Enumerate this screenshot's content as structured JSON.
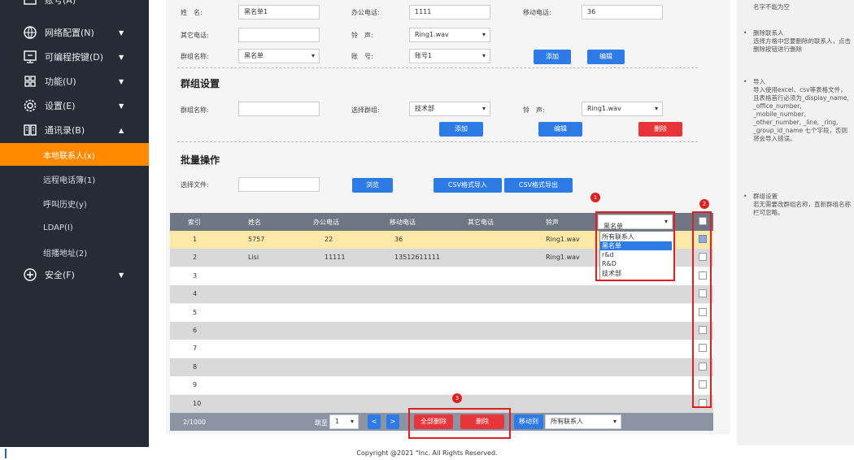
{
  "sidebar": {
    "top_partial_label": "账号(A)",
    "items": [
      {
        "label": "网络配置(N)",
        "icon": "globe-icon",
        "arrow": "▼"
      },
      {
        "label": "可编程按键(D)",
        "icon": "keyboard-icon",
        "arrow": "▼"
      },
      {
        "label": "功能(U)",
        "icon": "grid-icon",
        "arrow": "▼"
      },
      {
        "label": "设置(E)",
        "icon": "gear-icon",
        "arrow": "▼"
      },
      {
        "label": "通讯录(B)",
        "icon": "book-icon",
        "arrow": "▲"
      }
    ],
    "sub_items": [
      {
        "label": "本地联系人(x)",
        "active": true
      },
      {
        "label": "远程电话簿(1)",
        "active": false
      },
      {
        "label": "呼叫历史(y)",
        "active": false
      },
      {
        "label": "LDAP(I)",
        "active": false
      },
      {
        "label": "组播地址(2)",
        "active": false
      }
    ],
    "security": {
      "label": "安全(F)",
      "icon": "shield-plus-icon",
      "arrow": "▼"
    }
  },
  "contact_form": {
    "name_label": "姓　名:",
    "name_value": "黑名单1",
    "office_label": "办公电话:",
    "office_value": "1111",
    "mobile_label": "移动电话:",
    "mobile_value": "36",
    "other_label": "其它电话:",
    "other_value": "",
    "ring_label": "铃　声:",
    "ring_value": "Ring1.wav",
    "group_label": "群组名称:",
    "group_value": "黑名单",
    "account_label": "账　号:",
    "account_value": "账号1",
    "add_label": "添加",
    "edit_label": "编辑"
  },
  "group_settings": {
    "title": "群组设置",
    "group_name_label": "群组名称:",
    "group_name_value": "",
    "select_group_label": "选择群组:",
    "select_group_value": "技术部",
    "ring_label": "铃　声:",
    "ring_value": "Ring1.wav",
    "add_label": "添加",
    "edit_label": "编辑",
    "delete_label": "删除"
  },
  "batch": {
    "title": "批量操作",
    "file_label": "选择文件:",
    "file_value": "",
    "browse_label": "浏览",
    "import_label": "CSV格式导入",
    "export_label": "CSV格式导出"
  },
  "table": {
    "headers": [
      "索引",
      "姓名",
      "办公电话",
      "移动电话",
      "其它电话",
      "铃声"
    ],
    "filter_value": "黑名单",
    "filter_options": [
      "所有联系人",
      "黑名单",
      "r&d",
      "R&D",
      "技术部"
    ],
    "rows": [
      {
        "index": "1",
        "name": "5757",
        "office": "22",
        "mobile": "36",
        "other": "",
        "ring": "Ring1.wav",
        "checked": true
      },
      {
        "index": "2",
        "name": "Lisi",
        "office": "11111",
        "mobile": "13512611111",
        "other": "",
        "ring": "Ring1.wav",
        "checked": false
      },
      {
        "index": "3",
        "name": "",
        "office": "",
        "mobile": "",
        "other": "",
        "ring": "",
        "checked": false
      },
      {
        "index": "4",
        "name": "",
        "office": "",
        "mobile": "",
        "other": "",
        "ring": "",
        "checked": false
      },
      {
        "index": "5",
        "name": "",
        "office": "",
        "mobile": "",
        "other": "",
        "ring": "",
        "checked": false
      },
      {
        "index": "6",
        "name": "",
        "office": "",
        "mobile": "",
        "other": "",
        "ring": "",
        "checked": false
      },
      {
        "index": "7",
        "name": "",
        "office": "",
        "mobile": "",
        "other": "",
        "ring": "",
        "checked": false
      },
      {
        "index": "8",
        "name": "",
        "office": "",
        "mobile": "",
        "other": "",
        "ring": "",
        "checked": false
      },
      {
        "index": "9",
        "name": "",
        "office": "",
        "mobile": "",
        "other": "",
        "ring": "",
        "checked": false
      },
      {
        "index": "10",
        "name": "",
        "office": "",
        "mobile": "",
        "other": "",
        "ring": "",
        "checked": false
      }
    ],
    "pager": {
      "count": "2/1000",
      "goto_label": "跳至",
      "page_value": "1",
      "prev": "<",
      "next": ">",
      "delete_all_label": "全部删除",
      "delete_label": "删除",
      "move_label": "移动到",
      "move_target": "所有联系人"
    },
    "badges": [
      "1",
      "2",
      "3"
    ]
  },
  "help": {
    "top_partial": "名字不能为空",
    "items": [
      {
        "text": "删除联系人\n选择方格中您要删除的联系人，点击删除按钮进行删除"
      },
      {
        "text": "导入\n导入使用excel、csv等表格文件，且表格首行必须为_display_name, _office_number, _mobile_number, _other_number, _line, _ring, _group_id_name 七个字段，否则将会导入错误。"
      },
      {
        "text": "群组设置\n若无需要改群组名称，直新群组名称栏可忽略。"
      }
    ]
  },
  "footer": {
    "copyright": "Copyright @2021 \"Inc. All Rights Reserved."
  },
  "colors": {
    "sidebar_bg": "#262b36",
    "active": "#ff8a00",
    "blue": "#2e7be6",
    "red": "#e8353a",
    "highlight": "#e02020"
  }
}
